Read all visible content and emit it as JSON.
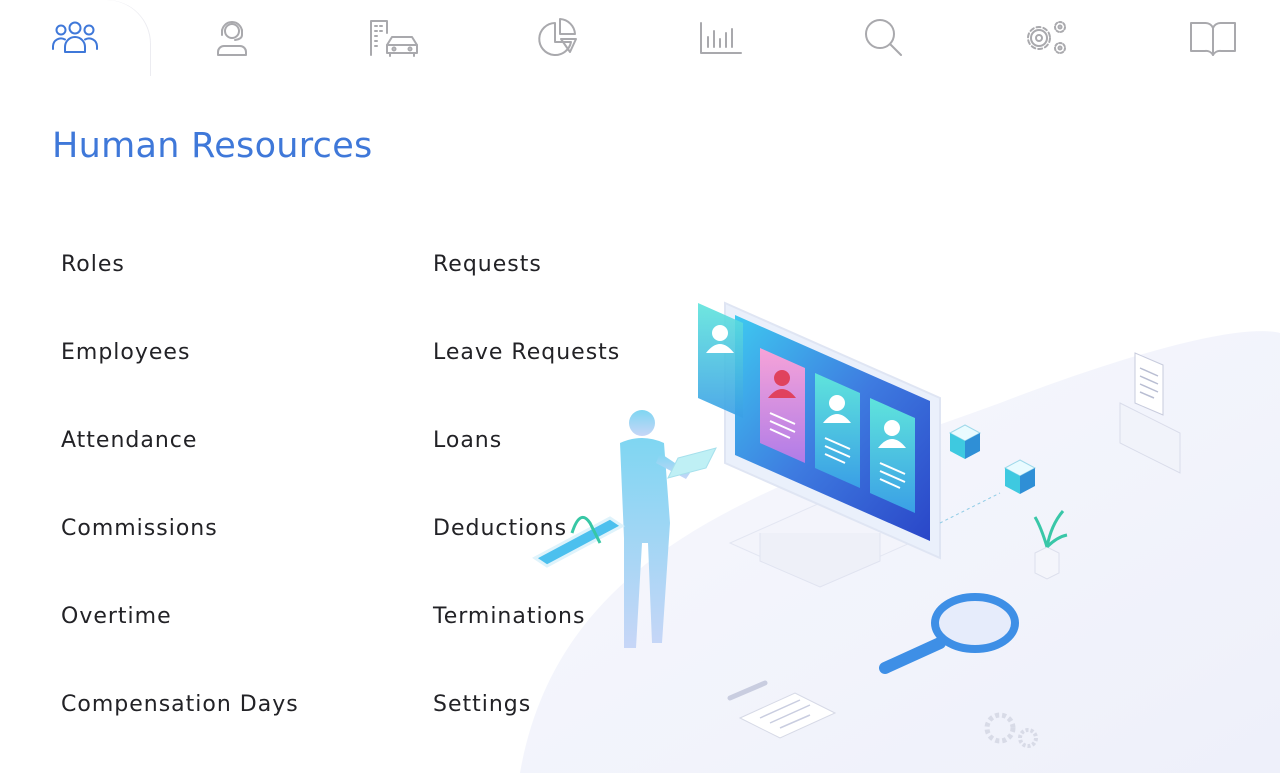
{
  "tabs": [
    {
      "name": "human-resources",
      "icon": "people-icon",
      "active": true
    },
    {
      "name": "support",
      "icon": "headset-agent-icon",
      "active": false
    },
    {
      "name": "assets",
      "icon": "building-car-icon",
      "active": false
    },
    {
      "name": "finance",
      "icon": "pie-chart-icon",
      "active": false
    },
    {
      "name": "reports",
      "icon": "bar-chart-icon",
      "active": false
    },
    {
      "name": "search",
      "icon": "search-icon",
      "active": false
    },
    {
      "name": "settings",
      "icon": "gears-icon",
      "active": false
    },
    {
      "name": "docs",
      "icon": "book-icon",
      "active": false
    }
  ],
  "page": {
    "title": "Human Resources"
  },
  "menu": {
    "left": [
      "Roles",
      "Employees",
      "Attendance",
      "Commissions",
      "Overtime",
      "Compensation Days"
    ],
    "right": [
      "Requests",
      "Leave Requests",
      "Loans",
      "Deductions",
      "Terminations",
      "Settings"
    ]
  },
  "colors": {
    "accent": "#3f78d9",
    "icon_inactive": "#a9a9ad",
    "text": "#222226"
  }
}
